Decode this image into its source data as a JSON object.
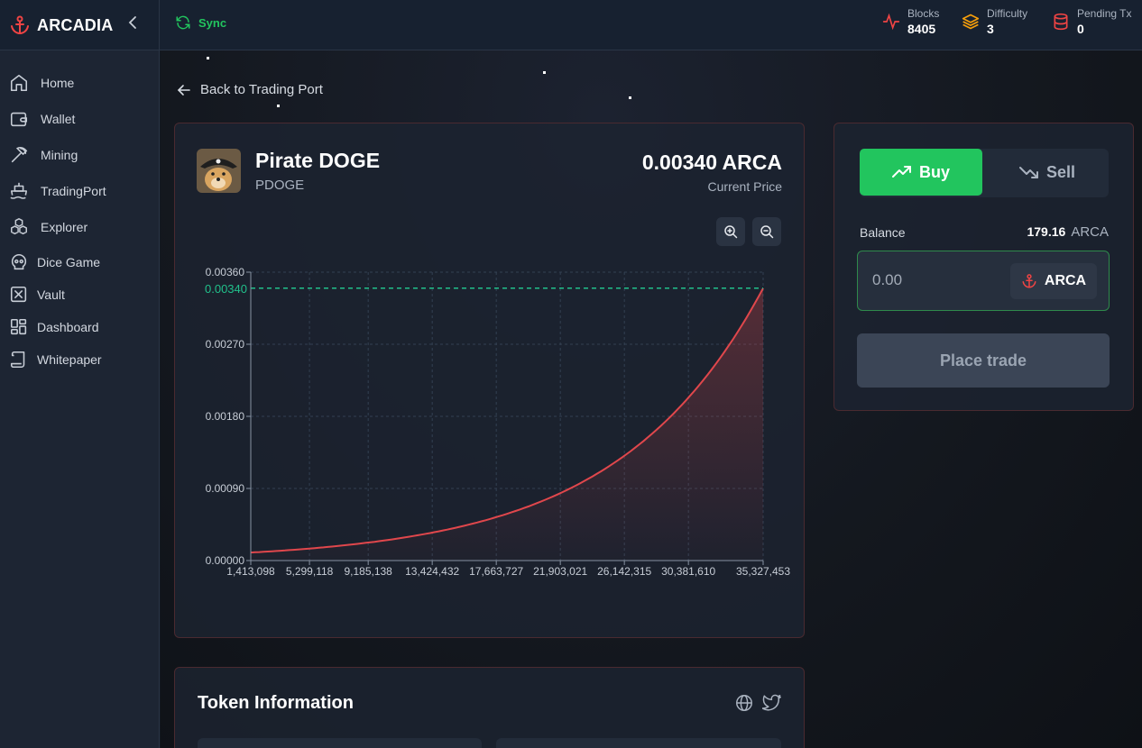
{
  "brand": {
    "name": "ARCADIA"
  },
  "header": {
    "sync_label": "Sync",
    "stats": [
      {
        "label": "Blocks",
        "value": "8405",
        "icon": "activity-icon",
        "color": "#ef4444"
      },
      {
        "label": "Difficulty",
        "value": "3",
        "icon": "layers-icon",
        "color": "#f59e0b"
      },
      {
        "label": "Pending Tx",
        "value": "0",
        "icon": "database-icon",
        "color": "#ef4444"
      }
    ]
  },
  "sidebar": {
    "items": [
      {
        "label": "Home",
        "icon": "home-icon"
      },
      {
        "label": "Wallet",
        "icon": "wallet-icon"
      },
      {
        "label": "Mining",
        "icon": "pickaxe-icon"
      },
      {
        "label": "TradingPort",
        "icon": "ship-icon"
      },
      {
        "label": "Explorer",
        "icon": "blocks-icon"
      },
      {
        "label": "Dice Game",
        "icon": "skull-icon"
      },
      {
        "label": "Vault",
        "icon": "vault-icon"
      },
      {
        "label": "Dashboard",
        "icon": "grid-icon"
      },
      {
        "label": "Whitepaper",
        "icon": "scroll-icon"
      }
    ]
  },
  "main": {
    "back_label": "Back to Trading Port",
    "token": {
      "name": "Pirate DOGE",
      "symbol": "PDOGE",
      "price": "0.00340 ARCA",
      "price_label": "Current Price"
    },
    "trade": {
      "buy_label": "Buy",
      "sell_label": "Sell",
      "balance_label": "Balance",
      "balance_value": "179.16",
      "balance_unit": "ARCA",
      "amount_placeholder": "0.00",
      "currency": "ARCA",
      "place_label": "Place trade"
    },
    "info": {
      "title": "Token Information"
    }
  },
  "colors": {
    "accent": "#22c55e",
    "curve": "#e0474c",
    "current_line": "#21c08b"
  },
  "chart_data": {
    "type": "area",
    "x": [
      1413098,
      5299118,
      9185138,
      13424432,
      17663727,
      21903021,
      26142315,
      30381610,
      35327453
    ],
    "x_tick_labels": [
      "1,413,098",
      "5,299,118",
      "9,185,138",
      "13,424,432",
      "17,663,727",
      "21,903,021",
      "26,142,315",
      "30,381,610",
      "35,327,453"
    ],
    "y_ticks": [
      "0.00000",
      "0.00090",
      "0.00180",
      "0.00270",
      "0.00360"
    ],
    "y_tick_values": [
      0,
      0.0009,
      0.0018,
      0.0027,
      0.0036
    ],
    "series": [
      {
        "values": [
          0.0001,
          0.00018,
          0.00027,
          0.00039,
          0.00058,
          0.0009,
          0.00145,
          0.00225,
          0.0034
        ]
      }
    ],
    "current_price": 0.0034,
    "current_price_label": "0.00340",
    "ylim": [
      0,
      0.0036
    ],
    "grid": true
  }
}
